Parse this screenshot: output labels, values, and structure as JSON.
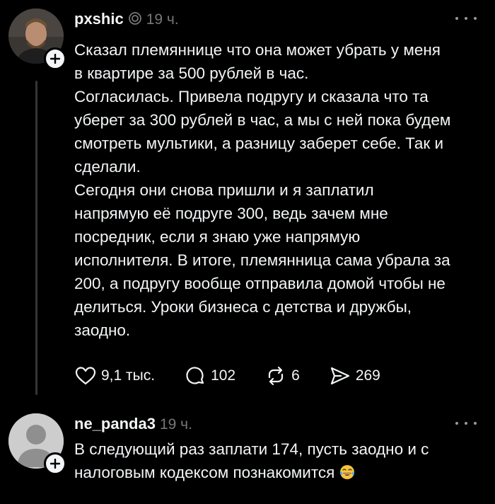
{
  "posts": [
    {
      "username": "pxshic",
      "time": "19 ч.",
      "text": "Сказал племяннице что она может убрать у меня\nв квартире за 500 рублей в час.\nСогласилась. Привела подругу и сказала что та\nуберет за 300 рублей в час, а мы с ней пока будем\nсмотреть мультики, а разницу заберет себе. Так и\nсделали.\nСегодня они снова пришли и я заплатил\nнапрямую её подруге 300, ведь зачем мне\nпосредник, если я знаю уже напрямую\nисполнителя. В итоге, племянница сама убрала за\n200, а подругу вообще отправила домой чтобы не\nделиться. Уроки бизнеса с детства и дружбы,\nзаодно.",
      "likes": "9,1 тыс.",
      "replies": "102",
      "reposts": "6",
      "shares": "269"
    },
    {
      "username": "ne_panda3",
      "time": "19 ч.",
      "text": "В следующий раз заплати 174, пусть заодно и с\nналоговым кодексом познакомится",
      "emoji": "laughing-tears-emoji"
    }
  ],
  "colors": {
    "background": "#000000",
    "text": "#f3f5f7",
    "secondary": "#777777",
    "thread_line": "#333638"
  }
}
